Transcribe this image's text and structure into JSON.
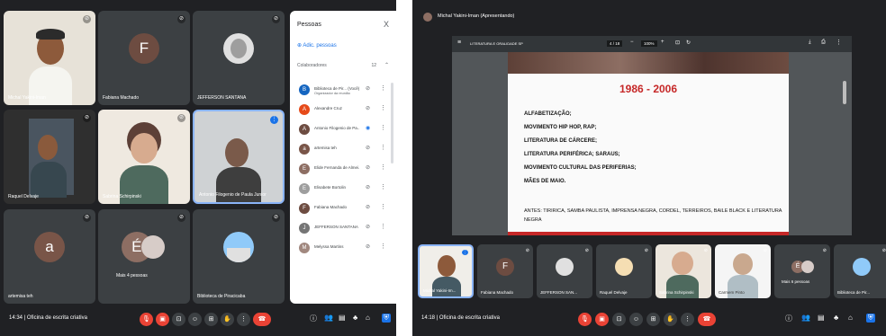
{
  "left": {
    "tiles": [
      {
        "name": "Michal Yakini-Iman",
        "type": "photo"
      },
      {
        "name": "Fabiana Machado",
        "initial": "F",
        "color": "#6d4c41"
      },
      {
        "name": "JEFFERSON SANTANA",
        "type": "photo"
      },
      {
        "name": "Raquel Delvaje",
        "type": "photo"
      },
      {
        "name": "Sabrina Schirpinski",
        "type": "photo"
      },
      {
        "name": "Antonio Filogenio de Paula Junior",
        "type": "photo"
      },
      {
        "name": "artemisa teh",
        "initial": "a",
        "color": "#795548"
      },
      {
        "name": "Mais 4 pessoas",
        "initial": "É",
        "color": "#8d6e63"
      },
      {
        "name": "Biblioteca de Piracicaba",
        "type": "photo"
      }
    ],
    "panel": {
      "title": "Pessoas",
      "close": "X",
      "add": "Adic. pessoas",
      "section": "Colaboradores",
      "count": "12",
      "participants": [
        {
          "name": "Biblioteca de Pir... (Você)",
          "sub": "Organizador da reunião",
          "color": "#1565c0",
          "initial": "B"
        },
        {
          "name": "Alexandre Cruz",
          "color": "#e64a19",
          "initial": "A"
        },
        {
          "name": "Antonio Filogenio de Pa...",
          "color": "#6d4c41",
          "initial": "A"
        },
        {
          "name": "artemisa teh",
          "color": "#795548",
          "initial": "a"
        },
        {
          "name": "Elide Fernanda de Almei...",
          "color": "#8d6e63",
          "initial": "E"
        },
        {
          "name": "Elisabete Bortolin",
          "color": "#9e9e9e",
          "initial": "E"
        },
        {
          "name": "Fabiana Machado",
          "color": "#6d4c41",
          "initial": "F"
        },
        {
          "name": "JEFFERSON SANTANA",
          "color": "#757575",
          "initial": "J"
        },
        {
          "name": "Melyssa Martins",
          "color": "#a1887f",
          "initial": "M"
        }
      ]
    },
    "bar": {
      "time": "14:34 | Oficina de escrita criativa"
    }
  },
  "right": {
    "presenter": "Michal Yakini-Iman (Apresentando)",
    "viewer": {
      "doc": "LITERATURA E ORALIDADE SP",
      "page": "4 / 18",
      "zoom": "100%"
    },
    "slide": {
      "title": "1986 - 2006",
      "items": [
        "ALFABETIZAÇÃO;",
        "MOVIMENTO HIP HOP, RAP;",
        "LITERATURA DE CÁRCERE;",
        "LITERATURA PERIFÉRICA; SARAUS;",
        "MOVIMENTO CULTURAL DAS PERIFERIAS;",
        "MÃES DE MAIO."
      ],
      "antes": "ANTES: TIRIRICA, SAMBA PAULISTA, IMPRENSA NEGRA, CORDEL, TERREIROS, BAILE BLACK E LITERATURA NEGRA"
    },
    "strip": [
      {
        "name": "Michal Yakini-Im...",
        "type": "photo"
      },
      {
        "name": "Fabiana Machado",
        "initial": "F",
        "color": "#6d4c41"
      },
      {
        "name": "JEFFERSON SAN...",
        "type": "photo"
      },
      {
        "name": "Raquel Delvaje",
        "type": "photo"
      },
      {
        "name": "Sabrina Schirpinski",
        "type": "photo"
      },
      {
        "name": "Carmem Pinto",
        "type": "photo"
      },
      {
        "name": "Mais 6 pessoas",
        "initial": "É",
        "color": "#8d6e63"
      },
      {
        "name": "Biblioteca de Pir...",
        "type": "photo"
      }
    ],
    "bar": {
      "time": "14:18 | Oficina de escrita criativa"
    }
  }
}
